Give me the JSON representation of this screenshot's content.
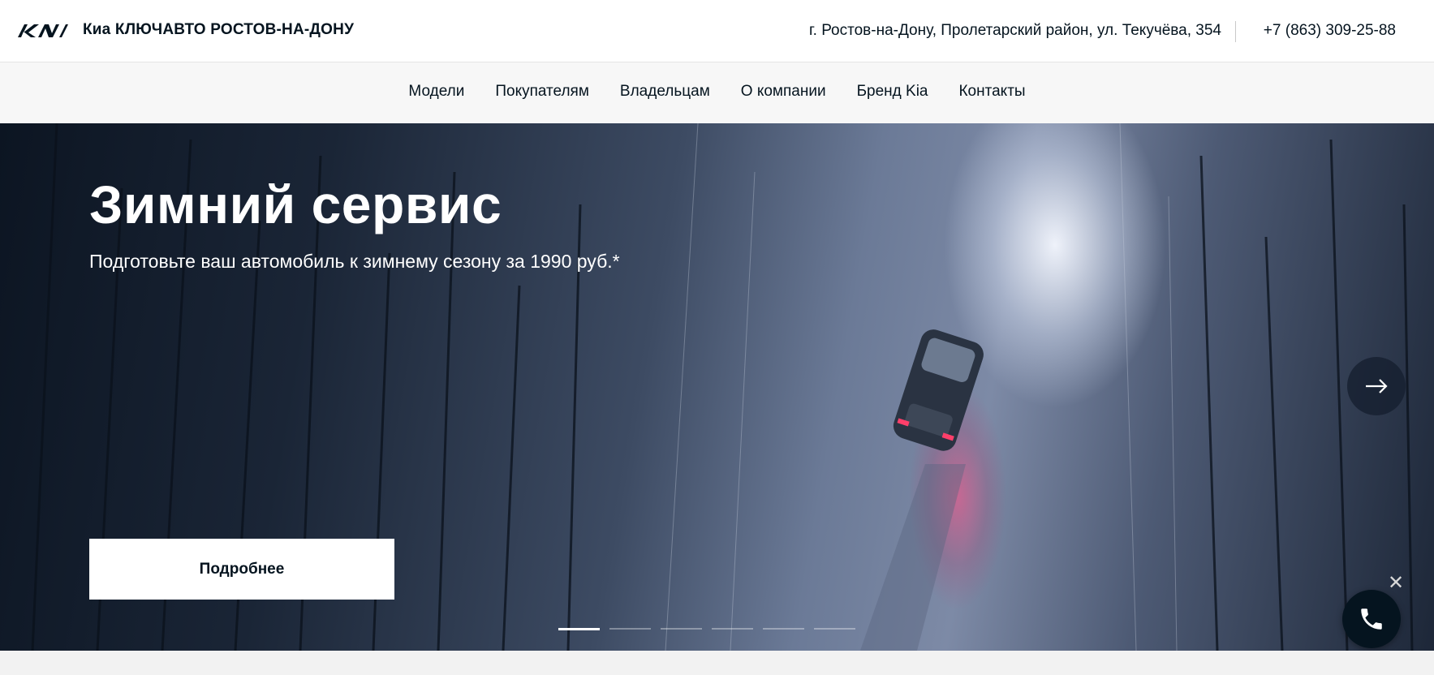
{
  "header": {
    "logo_icon": "kia-logo",
    "dealer_name": "Киа КЛЮЧАВТО РОСТОВ-НА-ДОНУ",
    "address": "г. Ростов-на-Дону, Пролетарский район, ул. Текучёва, 354",
    "phone": "+7 (863) 309-25-88"
  },
  "nav": {
    "items": [
      {
        "label": "Модели"
      },
      {
        "label": "Покупателям"
      },
      {
        "label": "Владельцам"
      },
      {
        "label": "О компании"
      },
      {
        "label": "Бренд Kia"
      },
      {
        "label": "Контакты"
      }
    ]
  },
  "hero": {
    "title": "Зимний сервис",
    "subtitle": "Подготовьте ваш автомобиль к зимнему сезону за 1990 руб.*",
    "button_label": "Подробнее",
    "next_icon": "arrow-right-icon",
    "slides_total": 6,
    "active_slide": 1
  },
  "widget": {
    "close_icon": "close-icon",
    "call_icon": "phone-icon"
  },
  "colors": {
    "brand_dark": "#05141f",
    "nav_bg": "#f7f7f7",
    "button_bg": "#ffffff"
  }
}
